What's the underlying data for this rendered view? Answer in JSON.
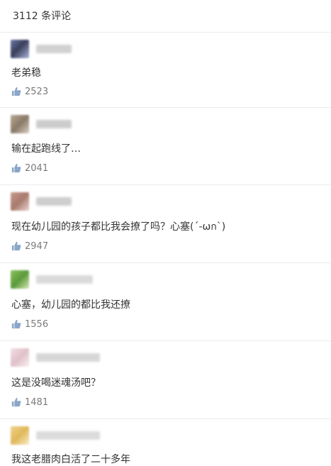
{
  "header": {
    "title": "3112 条评论"
  },
  "comments": [
    {
      "text": "老弟稳",
      "likes": "2523",
      "avatar_colors": [
        "#3a3f5a",
        "#8fa0c8"
      ],
      "name_color": "#c9c9c9"
    },
    {
      "text": "输在起跑线了…",
      "likes": "2041",
      "avatar_colors": [
        "#8a7a68",
        "#c8bfb2"
      ],
      "name_color": "#c4c4c4"
    },
    {
      "text": "现在幼儿园的孩子都比我会撩了吗？心塞(´-ωก`)",
      "likes": "2947",
      "avatar_colors": [
        "#a87a6e",
        "#d8bcb2"
      ],
      "name_color": "#c6c6c6"
    },
    {
      "text": "心塞，幼儿园的都比我还撩",
      "likes": "1556",
      "avatar_colors": [
        "#6aa24a",
        "#c9d9a8"
      ],
      "name_color": "#d4d4d4"
    },
    {
      "text": "这是没喝迷魂汤吧？",
      "likes": "1481",
      "avatar_colors": [
        "#e8d0d4",
        "#f4ecee"
      ],
      "name_color": "#d0d0d0"
    },
    {
      "text": "我这老腊肉白活了二十多年",
      "likes": "",
      "avatar_colors": [
        "#e6c46a",
        "#f3e4b8"
      ],
      "name_color": "#d6d6d6"
    }
  ],
  "icons": {
    "like": "thumbs-up-icon"
  }
}
